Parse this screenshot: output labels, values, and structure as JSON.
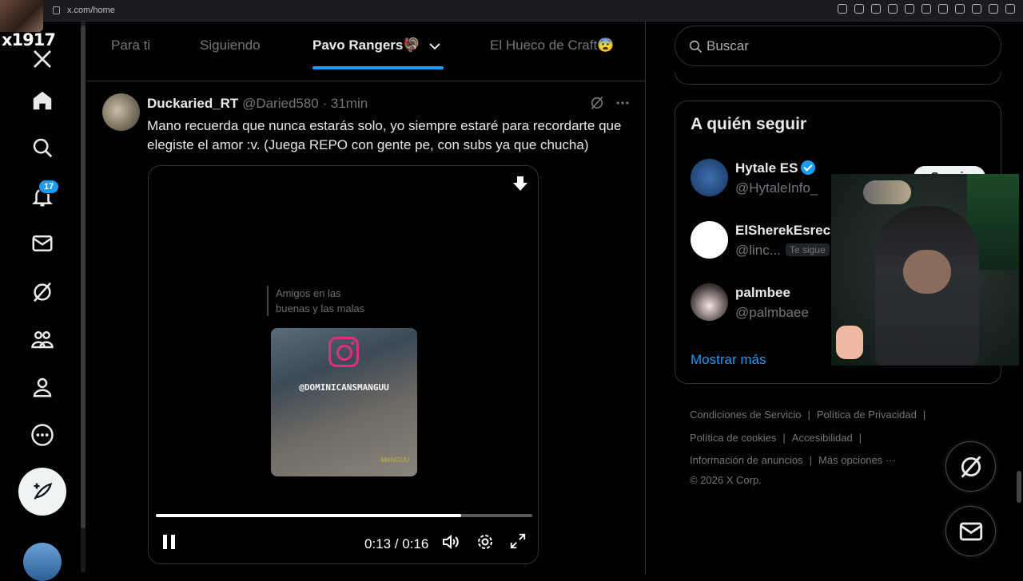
{
  "browser": {
    "url": "x.com/home"
  },
  "overlay_text": "x1917",
  "nav": {
    "notifications_count": "17"
  },
  "tabs": [
    {
      "label": "Para ti"
    },
    {
      "label": "Siguiendo"
    },
    {
      "label": "Pavo Rangers🦃"
    },
    {
      "label": "El Hueco de Craft😨"
    }
  ],
  "post": {
    "author_name": "Duckaried_RT",
    "author_meta": "@Daried580 · 31min",
    "text": "Mano recuerda que nunca estarás solo, yo siempre estaré para recordarte que elegiste el amor :v. (Juega REPO con gente pe, con subs ya que chucha)",
    "video": {
      "caption_line1": "Amigos en las",
      "caption_line2": "buenas y las malas",
      "handle": "@DOMINICANSMANGUU",
      "time": "0:13 / 0:16",
      "progress": 0.81
    }
  },
  "search": {
    "placeholder": "Buscar"
  },
  "who_to_follow": {
    "title": "A quién seguir",
    "follow_label": "Seguir",
    "items": [
      {
        "name": "Hytale ES",
        "handle": "@HytaleInfo_",
        "verified": true
      },
      {
        "name": "ElSherekEsrec",
        "handle": "@linc...",
        "follows_you": "Te sigue"
      },
      {
        "name": "palmbee",
        "handle": "@palmbaee"
      }
    ],
    "show_more": "Mostrar más"
  },
  "footer": {
    "terms": "Condiciones de Servicio",
    "privacy": "Política de Privacidad",
    "cookies": "Política de cookies",
    "accessibility": "Accesibilidad",
    "ads_info": "Información de anuncios",
    "more": "Más opciones ···",
    "copyright": "© 2026 X Corp."
  },
  "colors": {
    "accent": "#1d9bf0",
    "background": "#000000",
    "text": "#e7e9ea",
    "muted": "#71767b"
  }
}
